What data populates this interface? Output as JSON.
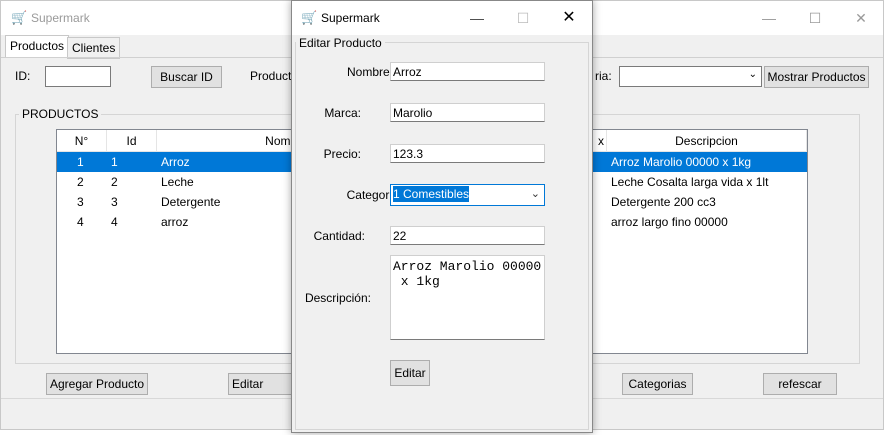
{
  "main_window": {
    "title": "Supermark",
    "controls": {
      "minimize": "—",
      "maximize": "☐",
      "close": "✕"
    },
    "tabs": [
      {
        "label": "Productos"
      },
      {
        "label": "Clientes"
      }
    ],
    "toolbar": {
      "id_label": "ID:",
      "id_value": "",
      "search_button": "Buscar ID",
      "product_label": "Product",
      "category_label": "ria:",
      "category_value": "",
      "show_products_button": "Mostrar Productos"
    },
    "products_group_label": "PRODUCTOS",
    "table": {
      "columns": [
        "N°",
        "Id",
        "Nombre",
        "x",
        "Descripcion"
      ],
      "rows": [
        {
          "n": "1",
          "id": "1",
          "nombre": "Arroz",
          "descripcion": "Arroz Marolio 00000 x 1kg",
          "selected": true
        },
        {
          "n": "2",
          "id": "2",
          "nombre": "Leche",
          "descripcion": "Leche Cosalta larga vida x 1lt",
          "selected": false
        },
        {
          "n": "3",
          "id": "3",
          "nombre": "Detergente",
          "descripcion": "Detergente 200 cc3",
          "selected": false
        },
        {
          "n": "4",
          "id": "4",
          "nombre": "arroz",
          "descripcion": "arroz largo fino 00000",
          "selected": false
        }
      ]
    },
    "bottom_buttons": {
      "add": "Agregar Producto",
      "edit": "Editar Produ",
      "categories": "Categorias",
      "refresh": "refescar"
    }
  },
  "dialog": {
    "title": "Supermark",
    "controls": {
      "minimize": "—",
      "maximize": "☐",
      "close": "✕"
    },
    "group_label": "Editar Producto",
    "fields": {
      "nombre_label": "Nombre:",
      "nombre_value": "Arroz",
      "marca_label": "Marca:",
      "marca_value": "Marolio",
      "precio_label": "Precio:",
      "precio_value": "123.3",
      "categoria_label": "Categoria:",
      "categoria_value": "1 Comestibles",
      "cantidad_label": "Cantidad:",
      "cantidad_value": "22",
      "descripcion_label": "Descripción:",
      "descripcion_value": "Arroz Marolio 00000\n x 1kg"
    },
    "submit_button": "Editar"
  },
  "colors": {
    "selection": "#0078d7",
    "window_bg": "#f0f0f0"
  }
}
